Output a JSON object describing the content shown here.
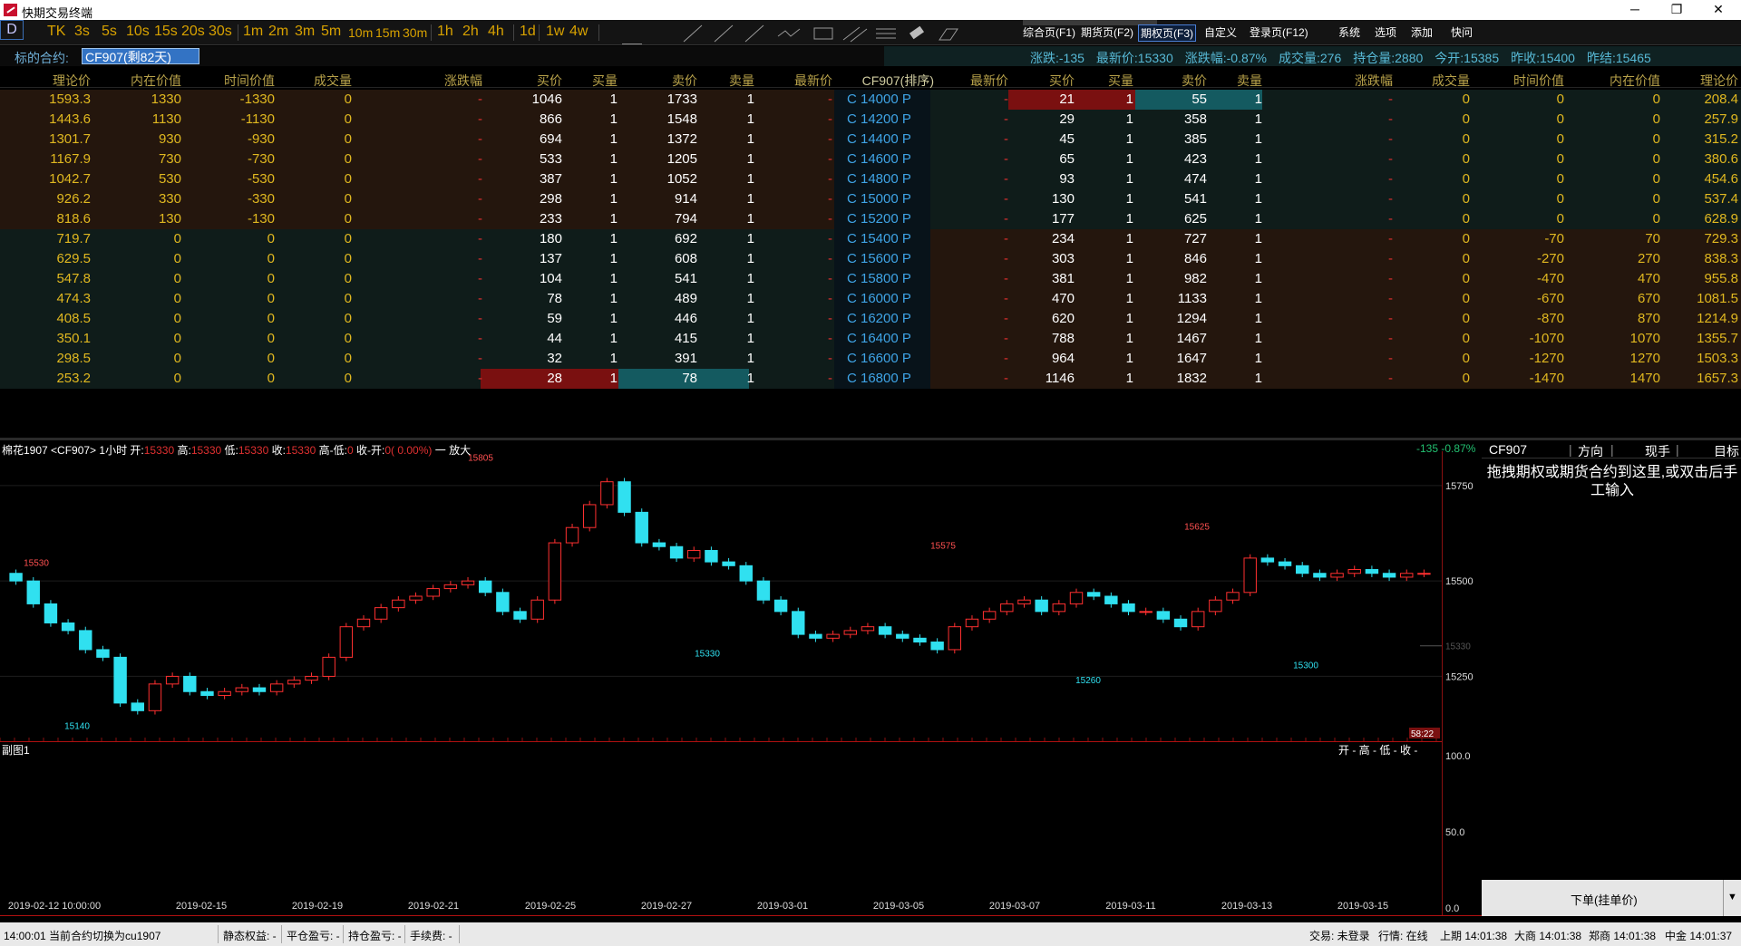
{
  "window": {
    "title": "快期交易终端",
    "min": "─",
    "max": "❐",
    "close": "✕"
  },
  "toolbar": {
    "periods": [
      "D",
      "TK",
      "3s",
      "5s",
      "10s",
      "15s",
      "20s",
      "30s",
      "1m",
      "2m",
      "3m",
      "5m",
      "10m",
      "15m",
      "30m",
      "1h",
      "2h",
      "4h",
      "1d",
      "1w",
      "4w"
    ],
    "pages": [
      "综合页(F1)",
      "期货页(F2)",
      "期权页(F3)",
      "自定义",
      "登录页(F12)",
      "系统",
      "选项",
      "添加",
      "快问"
    ],
    "active_page": "期权页(F3)"
  },
  "info": {
    "label": "标的合约:",
    "contract": "CF907(剩82天)",
    "stats": [
      "涨跌:-135",
      "最新价:15330",
      "涨跌幅:-0.87%",
      "成交量:276",
      "持仓量:2880",
      "今开:15385",
      "昨收:15400",
      "昨结:15465"
    ]
  },
  "table": {
    "headers_left": [
      "理论价",
      "内在价值",
      "时间价值",
      "成交量",
      "涨跌幅",
      "买价",
      "买量",
      "卖价",
      "卖量",
      "最新价"
    ],
    "header_mid": "CF907(排序)",
    "headers_right": [
      "最新价",
      "买价",
      "买量",
      "卖价",
      "卖量",
      "涨跌幅",
      "成交量",
      "时间价值",
      "内在价值",
      "理论价"
    ],
    "rows": [
      {
        "strike": "C 14000 P",
        "c": [
          "1593.3",
          "1330",
          "-1330",
          "0",
          "-",
          "1046",
          "1",
          "1733",
          "1",
          "-"
        ],
        "p": [
          "-",
          "21",
          "1",
          "55",
          "1",
          "-",
          "0",
          "0",
          "0",
          "208.4"
        ]
      },
      {
        "strike": "C 14200 P",
        "c": [
          "1443.6",
          "1130",
          "-1130",
          "0",
          "-",
          "866",
          "1",
          "1548",
          "1",
          "-"
        ],
        "p": [
          "-",
          "29",
          "1",
          "358",
          "1",
          "-",
          "0",
          "0",
          "0",
          "257.9"
        ]
      },
      {
        "strike": "C 14400 P",
        "c": [
          "1301.7",
          "930",
          "-930",
          "0",
          "-",
          "694",
          "1",
          "1372",
          "1",
          "-"
        ],
        "p": [
          "-",
          "45",
          "1",
          "385",
          "1",
          "-",
          "0",
          "0",
          "0",
          "315.2"
        ]
      },
      {
        "strike": "C 14600 P",
        "c": [
          "1167.9",
          "730",
          "-730",
          "0",
          "-",
          "533",
          "1",
          "1205",
          "1",
          "-"
        ],
        "p": [
          "-",
          "65",
          "1",
          "423",
          "1",
          "-",
          "0",
          "0",
          "0",
          "380.6"
        ]
      },
      {
        "strike": "C 14800 P",
        "c": [
          "1042.7",
          "530",
          "-530",
          "0",
          "-",
          "387",
          "1",
          "1052",
          "1",
          "-"
        ],
        "p": [
          "-",
          "93",
          "1",
          "474",
          "1",
          "-",
          "0",
          "0",
          "0",
          "454.6"
        ]
      },
      {
        "strike": "C 15000 P",
        "c": [
          "926.2",
          "330",
          "-330",
          "0",
          "-",
          "298",
          "1",
          "914",
          "1",
          "-"
        ],
        "p": [
          "-",
          "130",
          "1",
          "541",
          "1",
          "-",
          "0",
          "0",
          "0",
          "537.4"
        ]
      },
      {
        "strike": "C 15200 P",
        "c": [
          "818.6",
          "130",
          "-130",
          "0",
          "-",
          "233",
          "1",
          "794",
          "1",
          "-"
        ],
        "p": [
          "-",
          "177",
          "1",
          "625",
          "1",
          "-",
          "0",
          "0",
          "0",
          "628.9"
        ]
      },
      {
        "strike": "C 15400 P",
        "c": [
          "719.7",
          "0",
          "0",
          "0",
          "-",
          "180",
          "1",
          "692",
          "1",
          "-"
        ],
        "p": [
          "-",
          "234",
          "1",
          "727",
          "1",
          "-",
          "0",
          "-70",
          "70",
          "729.3"
        ]
      },
      {
        "strike": "C 15600 P",
        "c": [
          "629.5",
          "0",
          "0",
          "0",
          "-",
          "137",
          "1",
          "608",
          "1",
          "-"
        ],
        "p": [
          "-",
          "303",
          "1",
          "846",
          "1",
          "-",
          "0",
          "-270",
          "270",
          "838.3"
        ]
      },
      {
        "strike": "C 15800 P",
        "c": [
          "547.8",
          "0",
          "0",
          "0",
          "-",
          "104",
          "1",
          "541",
          "1",
          "-"
        ],
        "p": [
          "-",
          "381",
          "1",
          "982",
          "1",
          "-",
          "0",
          "-470",
          "470",
          "955.8"
        ]
      },
      {
        "strike": "C 16000 P",
        "c": [
          "474.3",
          "0",
          "0",
          "0",
          "-",
          "78",
          "1",
          "489",
          "1",
          "-"
        ],
        "p": [
          "-",
          "470",
          "1",
          "1133",
          "1",
          "-",
          "0",
          "-670",
          "670",
          "1081.5"
        ]
      },
      {
        "strike": "C 16200 P",
        "c": [
          "408.5",
          "0",
          "0",
          "0",
          "-",
          "59",
          "1",
          "446",
          "1",
          "-"
        ],
        "p": [
          "-",
          "620",
          "1",
          "1294",
          "1",
          "-",
          "0",
          "-870",
          "870",
          "1214.9"
        ]
      },
      {
        "strike": "C 16400 P",
        "c": [
          "350.1",
          "0",
          "0",
          "0",
          "-",
          "44",
          "1",
          "415",
          "1",
          "-"
        ],
        "p": [
          "-",
          "788",
          "1",
          "1467",
          "1",
          "-",
          "0",
          "-1070",
          "1070",
          "1355.7"
        ]
      },
      {
        "strike": "C 16600 P",
        "c": [
          "298.5",
          "0",
          "0",
          "0",
          "-",
          "32",
          "1",
          "391",
          "1",
          "-"
        ],
        "p": [
          "-",
          "964",
          "1",
          "1647",
          "1",
          "-",
          "0",
          "-1270",
          "1270",
          "1503.3"
        ]
      },
      {
        "strike": "C 16800 P",
        "c": [
          "253.2",
          "0",
          "0",
          "0",
          "-",
          "28",
          "1",
          "78",
          "1",
          "-"
        ],
        "p": [
          "-",
          "1146",
          "1",
          "1832",
          "1",
          "-",
          "0",
          "-1470",
          "1470",
          "1657.3"
        ]
      }
    ]
  },
  "chart": {
    "header": "棉花1907 <CF907> 1小时 开:",
    "open_v": "15330",
    "high_l": "高:",
    "high_v": "15330",
    "low_l": "低:",
    "low_v": "15330",
    "close_l": "收:",
    "close_v": "15330",
    "range_l": "高-低:",
    "range_v": "0",
    "chg_l": "收-开:",
    "chg_v": "0( 0.00%)",
    "zoom": "一 放大",
    "change": "-135 -0.87%",
    "time_label": "58:22",
    "current_price_label": "15330",
    "price_labels": [
      "15750",
      "15500",
      "15250"
    ],
    "annotations": [
      "15530",
      "15805",
      "15575",
      "15625",
      "15140",
      "15330",
      "15260",
      "15300"
    ],
    "dates": [
      "2019-02-12 10:00:00",
      "2019-02-15",
      "2019-02-19",
      "2019-02-21",
      "2019-02-25",
      "2019-02-27",
      "2019-03-01",
      "2019-03-05",
      "2019-03-07",
      "2019-03-11",
      "2019-03-13",
      "2019-03-15"
    ],
    "sub_title": "副图1",
    "sub_ohlc": "开 - 高 - 低 - 收 -",
    "sub_labels": [
      "100.0",
      "50.0",
      "0.0"
    ]
  },
  "right_panel": {
    "contract": "CF907",
    "dir": "方向",
    "hand": "现手",
    "target": "目标",
    "msg": "拖拽期权或期货合约到这里,或双击后手工输入",
    "order_btn": "下单(挂单价)"
  },
  "status": {
    "items": [
      "14:00:01 当前合约切换为cu1907",
      "静态权益: -",
      "平仓盈亏: -",
      "持仓盈亏: -",
      "手续费: -",
      "交易: 未登录",
      "行情: 在线",
      "上期 14:01:38",
      "大商 14:01:38",
      "郑商 14:01:38",
      "中金 14:01:37"
    ]
  },
  "colors": {
    "call_itm": "#2a1a10",
    "otm": "#0f1d1b",
    "bid_hl": "#7a1010",
    "ask_hl": "#145a60",
    "up": "#ff3030",
    "down": "#30e0f0"
  }
}
